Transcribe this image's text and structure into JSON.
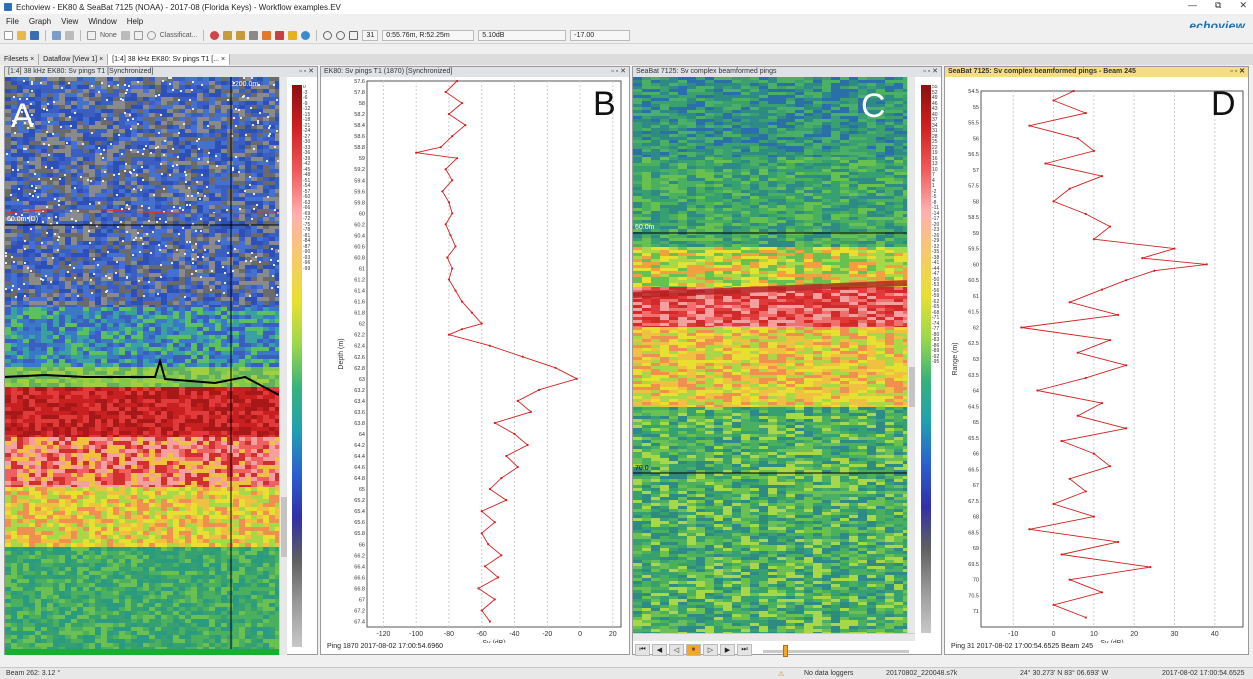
{
  "window": {
    "title": "Echoview - EK80 & SeaBat 7125 (NOAA) - 2017-08 (Florida Keys) - Workflow examples.EV",
    "logo": "echoview",
    "min": "—",
    "restore": "⧉",
    "close": "✕"
  },
  "menu": [
    "File",
    "Graph",
    "View",
    "Window",
    "Help"
  ],
  "toolbar": {
    "none_label": "None",
    "classification_label": "Classificat...",
    "ping_field": "31",
    "position_field": "0:55.76m, R:52.25m",
    "db_field": "5.10dB",
    "value_field": "-17.00"
  },
  "tabs": [
    "Filesets",
    "Dataflow [View 1]",
    "[1:4] 38 kHz EK80: Sv pings T1 [..."
  ],
  "tab_close": "×",
  "pane_controls": "▫ ▫ ✕",
  "panel_a": {
    "header": "[1:4] 38 kHz EK80: Sv pings T1 [Synchronized]",
    "label": "A",
    "range_marker": "1200.0m",
    "depth_marker": "60.0m (D)",
    "scale_ticks": [
      "0",
      "-3",
      "-6",
      "-9",
      "-12",
      "-15",
      "-18",
      "-21",
      "-24",
      "-27",
      "-30",
      "-33",
      "-36",
      "-39",
      "-42",
      "-45",
      "-48",
      "-51",
      "-54",
      "-57",
      "-60",
      "-63",
      "-66",
      "-69",
      "-72",
      "-75",
      "-78",
      "-81",
      "-84",
      "-87",
      "-90",
      "-93",
      "-96",
      "-99"
    ]
  },
  "panel_b": {
    "header": "EK80: Sv pings T1 (1870) [Synchronized]",
    "label": "B",
    "footer": "Ping 1870 2017-08-02 17:00:54.6960"
  },
  "panel_c": {
    "header": "SeaBat 7125: Sv complex beamformed pings",
    "label": "C",
    "marker_60": "60.0m",
    "marker_70": "70.0",
    "scale_ticks": [
      "55",
      "52",
      "49",
      "46",
      "43",
      "40",
      "37",
      "34",
      "31",
      "28",
      "25",
      "22",
      "19",
      "16",
      "13",
      "10",
      "7",
      "4",
      "1",
      "-2",
      "-5",
      "-8",
      "-11",
      "-14",
      "-17",
      "-20",
      "-23",
      "-26",
      "-29",
      "-32",
      "-35",
      "-38",
      "-41",
      "-44",
      "-47",
      "-50",
      "-53",
      "-56",
      "-59",
      "-62",
      "-65",
      "-68",
      "-71",
      "-74",
      "-77",
      "-80",
      "-83",
      "-86",
      "-89",
      "-92",
      "-95"
    ],
    "controls": [
      "⏮",
      "◀",
      "◁",
      "⏸",
      "▷",
      "▶",
      "⏭"
    ]
  },
  "panel_d": {
    "header": "SeaBat 7125: Sv complex beamformed pings - Beam 245",
    "label": "D",
    "footer": "Ping 31 2017-08-02 17:00:54.6525 Beam 245"
  },
  "status": {
    "beam": "Beam 262: 3.12 °",
    "loggers": "No data loggers",
    "file": "20170802_220048.s7k",
    "coords": "24° 30.273' N 83° 06.693' W",
    "time": "2017-08-02 17:00:54.6525"
  },
  "chart_data": [
    {
      "type": "line",
      "title": "",
      "xlabel": "Sv (dB)",
      "ylabel": "Depth (m)",
      "xlim": [
        -130,
        25
      ],
      "ylim": [
        57.6,
        67.5
      ],
      "xticks": [
        -120,
        -100,
        -80,
        -60,
        -40,
        -20,
        0,
        20
      ],
      "yticks": [
        57.6,
        57.8,
        58,
        58.2,
        58.4,
        58.6,
        58.8,
        59,
        59.2,
        59.4,
        59.6,
        59.8,
        60,
        60.2,
        60.4,
        60.6,
        60.8,
        61,
        61.2,
        61.4,
        61.6,
        61.8,
        62,
        62.2,
        62.4,
        62.6,
        62.8,
        63,
        63.2,
        63.4,
        63.6,
        63.8,
        64,
        64.2,
        64.4,
        64.6,
        64.8,
        65,
        65.2,
        65.4,
        65.6,
        65.8,
        66,
        66.2,
        66.4,
        66.6,
        66.8,
        67,
        67.2,
        67.4
      ],
      "series": [
        {
          "color": "#d42020",
          "y": [
            57.6,
            57.8,
            58,
            58.2,
            58.4,
            58.6,
            58.8,
            58.9,
            59,
            59.2,
            59.4,
            59.6,
            59.8,
            60,
            60.2,
            60.4,
            60.6,
            60.8,
            61,
            61.2,
            61.4,
            61.6,
            61.8,
            62,
            62.1,
            62.2,
            62.4,
            62.6,
            62.8,
            63,
            63.2,
            63.4,
            63.6,
            63.8,
            64,
            64.2,
            64.4,
            64.6,
            64.8,
            65,
            65.2,
            65.4,
            65.6,
            65.8,
            66,
            66.2,
            66.4,
            66.6,
            66.8,
            67,
            67.2,
            67.4
          ],
          "x": [
            -75,
            -82,
            -72,
            -80,
            -70,
            -78,
            -85,
            -100,
            -75,
            -82,
            -78,
            -84,
            -80,
            -78,
            -82,
            -79,
            -76,
            -81,
            -78,
            -80,
            -76,
            -72,
            -66,
            -60,
            -72,
            -80,
            -55,
            -35,
            -15,
            -2,
            -25,
            -38,
            -30,
            -52,
            -40,
            -32,
            -45,
            -38,
            -48,
            -55,
            -45,
            -60,
            -52,
            -60,
            -56,
            -48,
            -58,
            -50,
            -62,
            -52,
            -60,
            -55
          ]
        }
      ]
    },
    {
      "type": "line",
      "title": "",
      "xlabel": "Sv (dB)",
      "ylabel": "Range (m)",
      "xlim": [
        -18,
        47
      ],
      "ylim": [
        54.5,
        71.5
      ],
      "xticks": [
        -10,
        0,
        10,
        20,
        30,
        40
      ],
      "yticks": [
        54.5,
        55,
        55.5,
        56,
        56.5,
        57,
        57.5,
        58,
        58.5,
        59,
        59.5,
        60,
        60.5,
        61,
        61.5,
        62,
        62.5,
        63,
        63.5,
        64,
        64.5,
        65,
        65.5,
        66,
        66.5,
        67,
        67.5,
        68,
        68.5,
        69,
        69.5,
        70,
        70.5,
        71
      ],
      "series": [
        {
          "color": "#d42020",
          "y": [
            54.5,
            54.8,
            55.2,
            55.6,
            56,
            56.4,
            56.8,
            57.2,
            57.6,
            58,
            58.4,
            58.8,
            59.2,
            59.5,
            59.8,
            60,
            60.2,
            60.5,
            60.8,
            61.2,
            61.6,
            62,
            62.4,
            62.8,
            63.2,
            63.6,
            64,
            64.4,
            64.8,
            65.2,
            65.6,
            66,
            66.4,
            66.8,
            67.2,
            67.6,
            68,
            68.4,
            68.8,
            69.2,
            69.6,
            70,
            70.4,
            70.8,
            71.2
          ],
          "x": [
            5,
            0,
            8,
            -6,
            6,
            10,
            -2,
            12,
            4,
            0,
            8,
            14,
            10,
            30,
            22,
            38,
            25,
            18,
            12,
            4,
            16,
            -8,
            14,
            6,
            18,
            8,
            -4,
            12,
            6,
            18,
            2,
            10,
            14,
            4,
            8,
            0,
            10,
            -6,
            16,
            2,
            24,
            4,
            12,
            0,
            8
          ]
        }
      ]
    }
  ]
}
